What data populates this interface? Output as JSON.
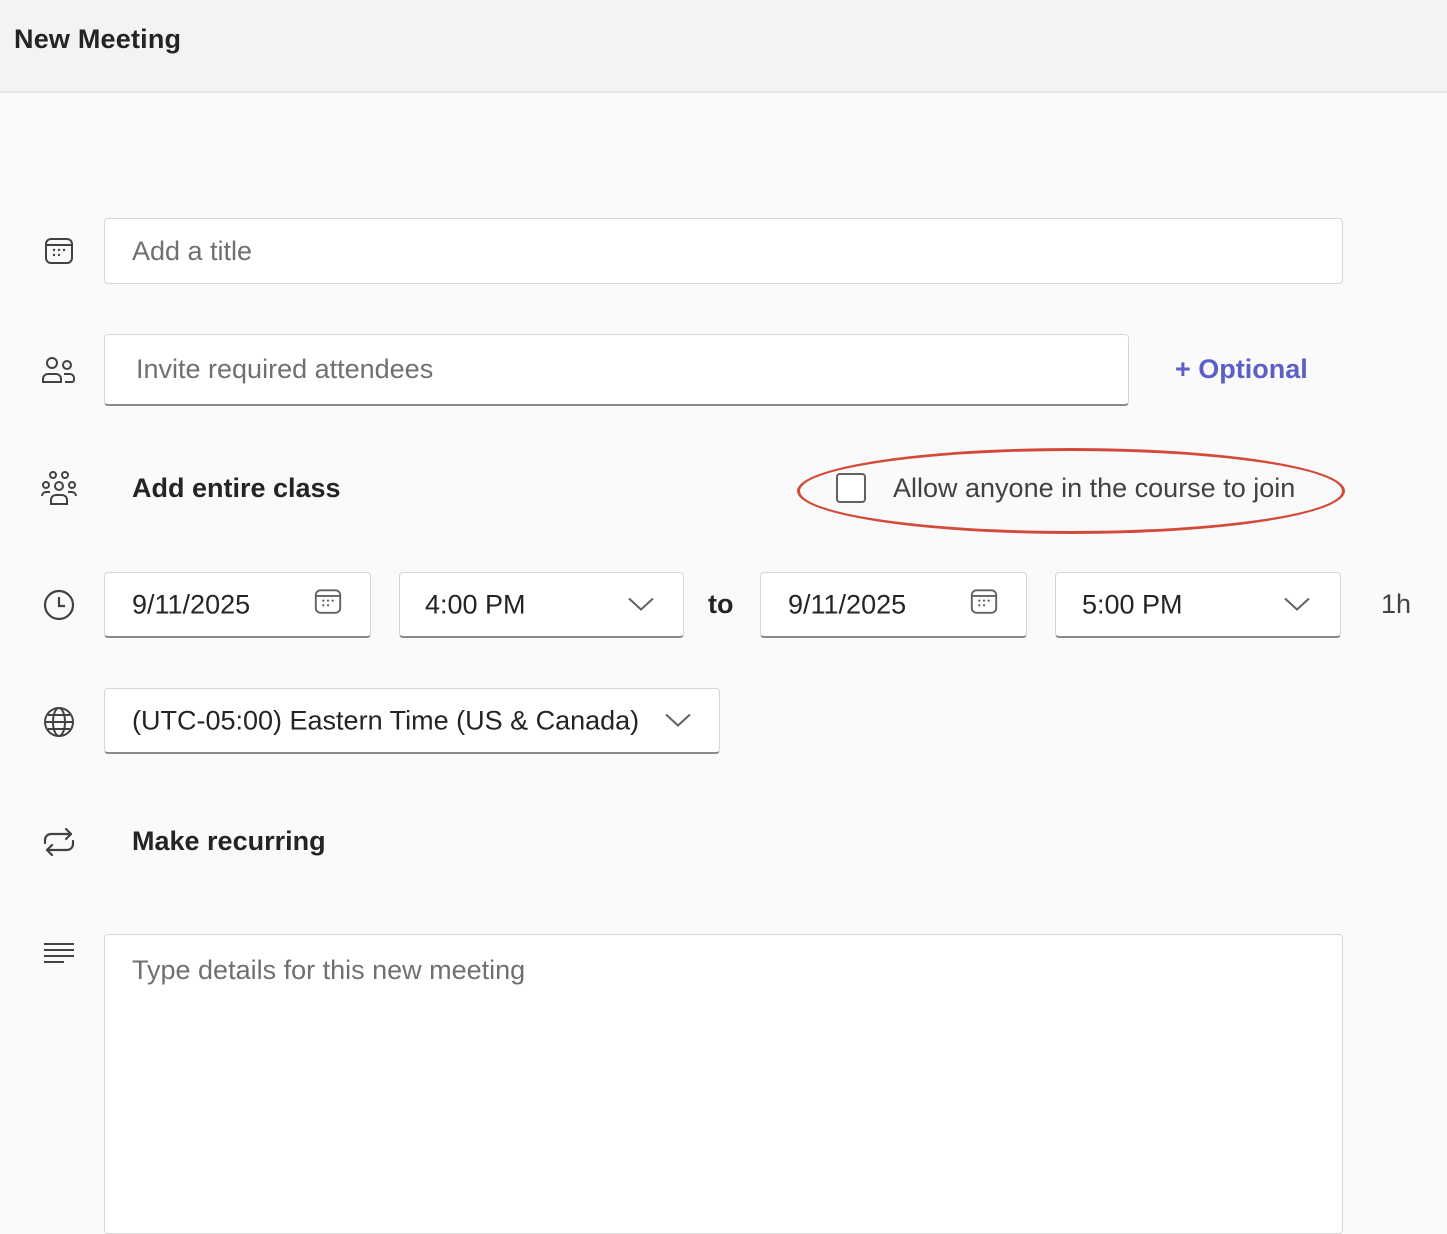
{
  "window": {
    "title": "New Meeting"
  },
  "form": {
    "title_placeholder": "Add a title",
    "attendees_placeholder": "Invite required attendees",
    "optional_link": "+ Optional",
    "add_class_label": "Add entire class",
    "allow_join_label": "Allow anyone in the course to join",
    "allow_join_checked": false,
    "start_date": "9/11/2025",
    "start_time": "4:00 PM",
    "to_label": "to",
    "end_date": "9/11/2025",
    "end_time": "5:00 PM",
    "duration": "1h",
    "timezone": "(UTC-05:00) Eastern Time (US & Canada)",
    "recurring_label": "Make recurring",
    "details_placeholder": "Type details for this new meeting"
  },
  "icons": {
    "title": "calendar-icon",
    "attendees": "people-icon",
    "class": "people-team-icon",
    "time": "clock-icon",
    "timezone": "globe-icon",
    "recurring": "repeat-icon",
    "details": "text-align-icon"
  },
  "colors": {
    "accent": "#5b5fc7",
    "highlight": "#d44a3a"
  }
}
